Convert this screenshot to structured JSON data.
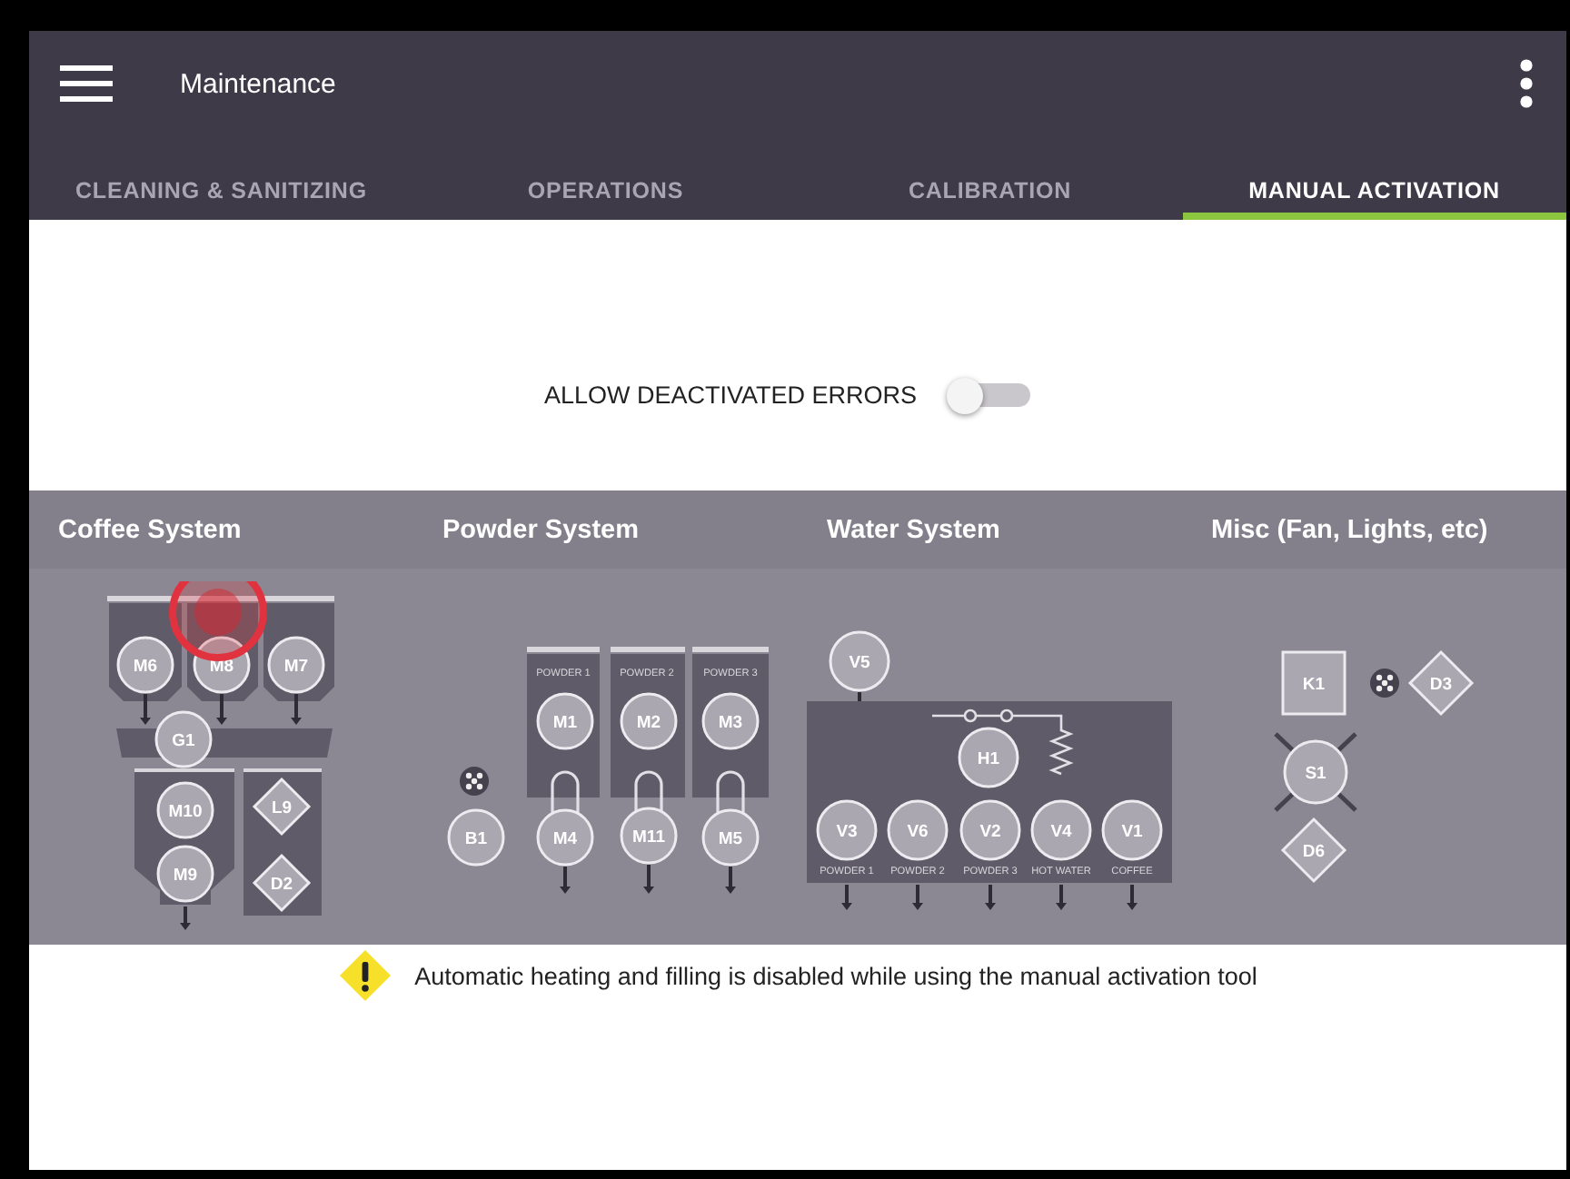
{
  "app_bar": {
    "title": "Maintenance"
  },
  "tabs": [
    {
      "label": "CLEANING & SANITIZING",
      "selected": false
    },
    {
      "label": "OPERATIONS",
      "selected": false
    },
    {
      "label": "CALIBRATION",
      "selected": false
    },
    {
      "label": "MANUAL ACTIVATION",
      "selected": true
    }
  ],
  "toggle": {
    "label": "ALLOW DEACTIVATED ERRORS",
    "on": false
  },
  "systems": [
    {
      "title": "Coffee System",
      "components": [
        {
          "label": "M6",
          "kind": "circle"
        },
        {
          "label": "M8",
          "kind": "circle"
        },
        {
          "label": "M7",
          "kind": "circle"
        },
        {
          "label": "G1",
          "kind": "circle"
        },
        {
          "label": "M10",
          "kind": "circle"
        },
        {
          "label": "L9",
          "kind": "diamond"
        },
        {
          "label": "M9",
          "kind": "circle"
        },
        {
          "label": "D2",
          "kind": "diamond"
        }
      ]
    },
    {
      "title": "Powder System",
      "captions": [
        "POWDER 1",
        "POWDER 2",
        "POWDER 3"
      ],
      "components": [
        {
          "label": "M1",
          "kind": "circle"
        },
        {
          "label": "M2",
          "kind": "circle"
        },
        {
          "label": "M3",
          "kind": "circle"
        },
        {
          "label": "B1",
          "kind": "circle"
        },
        {
          "label": "M4",
          "kind": "circle"
        },
        {
          "label": "M11",
          "kind": "circle"
        },
        {
          "label": "M5",
          "kind": "circle"
        }
      ]
    },
    {
      "title": "Water System",
      "captions": [
        "POWDER 1",
        "POWDER 2",
        "POWDER 3",
        "HOT WATER",
        "COFFEE"
      ],
      "components": [
        {
          "label": "V5",
          "kind": "circle"
        },
        {
          "label": "H1",
          "kind": "circle"
        },
        {
          "label": "V3",
          "kind": "circle"
        },
        {
          "label": "V6",
          "kind": "circle"
        },
        {
          "label": "V2",
          "kind": "circle"
        },
        {
          "label": "V4",
          "kind": "circle"
        },
        {
          "label": "V1",
          "kind": "circle"
        }
      ]
    },
    {
      "title": "Misc (Fan, Lights, etc)",
      "components": [
        {
          "label": "K1",
          "kind": "square"
        },
        {
          "label": "D3",
          "kind": "diamond"
        },
        {
          "label": "S1",
          "kind": "circle"
        },
        {
          "label": "D6",
          "kind": "diamond"
        }
      ]
    }
  ],
  "notice": "Automatic heating and filling is disabled while using the manual activation tool"
}
